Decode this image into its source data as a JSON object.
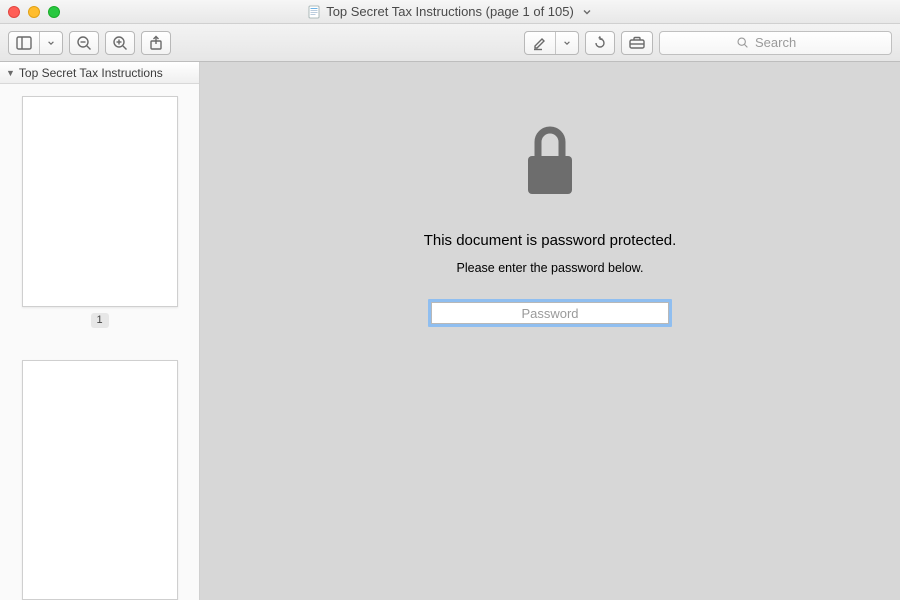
{
  "title": "Top Secret Tax Instructions (page 1 of 105)",
  "sidebar": {
    "doc_title": "Top Secret Tax Instructions",
    "thumbs": [
      {
        "label": "1"
      }
    ]
  },
  "toolbar": {
    "search_placeholder": "Search"
  },
  "protected": {
    "heading": "This document is password protected.",
    "subheading": "Please enter the password below.",
    "password_placeholder": "Password"
  }
}
